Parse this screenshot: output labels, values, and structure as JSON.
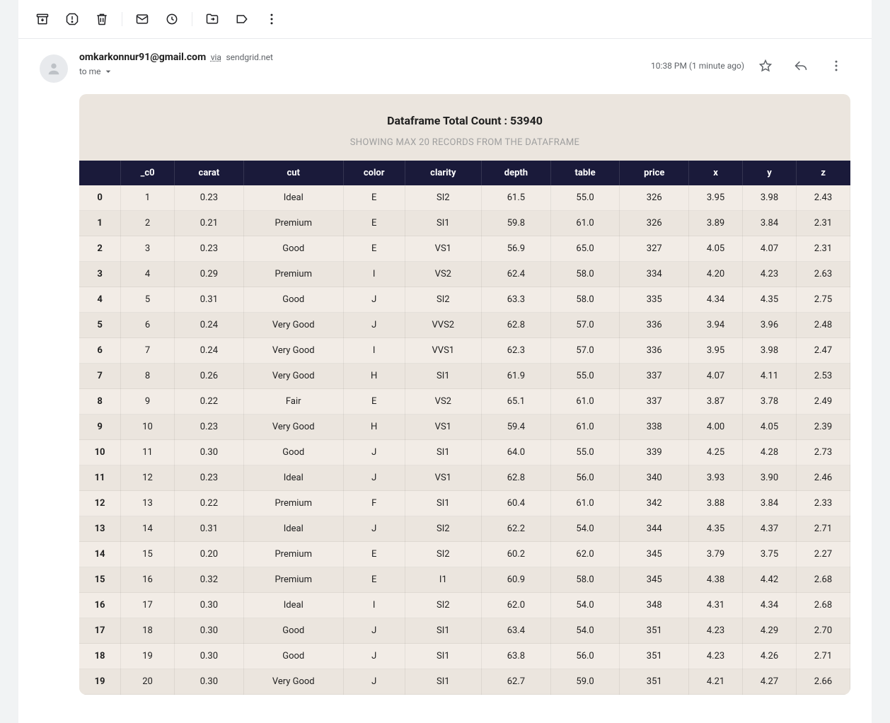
{
  "toolbar": {
    "archive": "Archive",
    "spam": "Report spam",
    "delete": "Delete",
    "unread": "Mark as unread",
    "snooze": "Snooze",
    "moveto": "Move to",
    "labels": "Labels",
    "more": "More"
  },
  "header": {
    "sender_email": "omkarkonnur91@gmail.com",
    "via_word": "via",
    "via_domain": "sendgrid.net",
    "to_text": "to me",
    "timestamp": "10:38 PM (1 minute ago)"
  },
  "content": {
    "title": "Dataframe Total Count : 53940",
    "subtitle": "SHOWING MAX 20 RECORDS FROM THE DATAFRAME",
    "columns": [
      "",
      "_c0",
      "carat",
      "cut",
      "color",
      "clarity",
      "depth",
      "table",
      "price",
      "x",
      "y",
      "z"
    ],
    "rows": [
      [
        "0",
        "1",
        "0.23",
        "Ideal",
        "E",
        "SI2",
        "61.5",
        "55.0",
        "326",
        "3.95",
        "3.98",
        "2.43"
      ],
      [
        "1",
        "2",
        "0.21",
        "Premium",
        "E",
        "SI1",
        "59.8",
        "61.0",
        "326",
        "3.89",
        "3.84",
        "2.31"
      ],
      [
        "2",
        "3",
        "0.23",
        "Good",
        "E",
        "VS1",
        "56.9",
        "65.0",
        "327",
        "4.05",
        "4.07",
        "2.31"
      ],
      [
        "3",
        "4",
        "0.29",
        "Premium",
        "I",
        "VS2",
        "62.4",
        "58.0",
        "334",
        "4.20",
        "4.23",
        "2.63"
      ],
      [
        "4",
        "5",
        "0.31",
        "Good",
        "J",
        "SI2",
        "63.3",
        "58.0",
        "335",
        "4.34",
        "4.35",
        "2.75"
      ],
      [
        "5",
        "6",
        "0.24",
        "Very Good",
        "J",
        "VVS2",
        "62.8",
        "57.0",
        "336",
        "3.94",
        "3.96",
        "2.48"
      ],
      [
        "6",
        "7",
        "0.24",
        "Very Good",
        "I",
        "VVS1",
        "62.3",
        "57.0",
        "336",
        "3.95",
        "3.98",
        "2.47"
      ],
      [
        "7",
        "8",
        "0.26",
        "Very Good",
        "H",
        "SI1",
        "61.9",
        "55.0",
        "337",
        "4.07",
        "4.11",
        "2.53"
      ],
      [
        "8",
        "9",
        "0.22",
        "Fair",
        "E",
        "VS2",
        "65.1",
        "61.0",
        "337",
        "3.87",
        "3.78",
        "2.49"
      ],
      [
        "9",
        "10",
        "0.23",
        "Very Good",
        "H",
        "VS1",
        "59.4",
        "61.0",
        "338",
        "4.00",
        "4.05",
        "2.39"
      ],
      [
        "10",
        "11",
        "0.30",
        "Good",
        "J",
        "SI1",
        "64.0",
        "55.0",
        "339",
        "4.25",
        "4.28",
        "2.73"
      ],
      [
        "11",
        "12",
        "0.23",
        "Ideal",
        "J",
        "VS1",
        "62.8",
        "56.0",
        "340",
        "3.93",
        "3.90",
        "2.46"
      ],
      [
        "12",
        "13",
        "0.22",
        "Premium",
        "F",
        "SI1",
        "60.4",
        "61.0",
        "342",
        "3.88",
        "3.84",
        "2.33"
      ],
      [
        "13",
        "14",
        "0.31",
        "Ideal",
        "J",
        "SI2",
        "62.2",
        "54.0",
        "344",
        "4.35",
        "4.37",
        "2.71"
      ],
      [
        "14",
        "15",
        "0.20",
        "Premium",
        "E",
        "SI2",
        "60.2",
        "62.0",
        "345",
        "3.79",
        "3.75",
        "2.27"
      ],
      [
        "15",
        "16",
        "0.32",
        "Premium",
        "E",
        "I1",
        "60.9",
        "58.0",
        "345",
        "4.38",
        "4.42",
        "2.68"
      ],
      [
        "16",
        "17",
        "0.30",
        "Ideal",
        "I",
        "SI2",
        "62.0",
        "54.0",
        "348",
        "4.31",
        "4.34",
        "2.68"
      ],
      [
        "17",
        "18",
        "0.30",
        "Good",
        "J",
        "SI1",
        "63.4",
        "54.0",
        "351",
        "4.23",
        "4.29",
        "2.70"
      ],
      [
        "18",
        "19",
        "0.30",
        "Good",
        "J",
        "SI1",
        "63.8",
        "56.0",
        "351",
        "4.23",
        "4.26",
        "2.71"
      ],
      [
        "19",
        "20",
        "0.30",
        "Very Good",
        "J",
        "SI1",
        "62.7",
        "59.0",
        "351",
        "4.21",
        "4.27",
        "2.66"
      ]
    ]
  }
}
